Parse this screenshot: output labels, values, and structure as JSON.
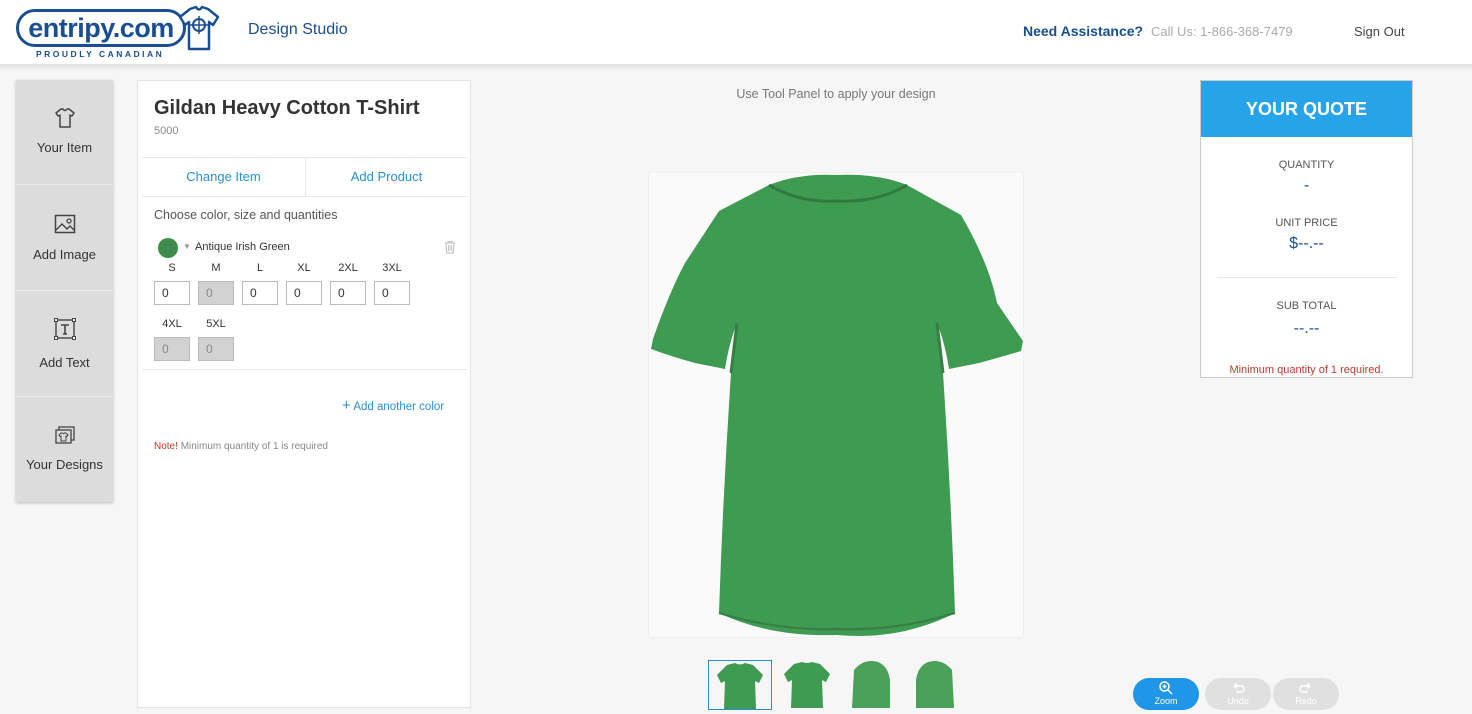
{
  "header": {
    "logo_text": "entripy.com",
    "logo_tagline": "PROUDLY CANADIAN",
    "app_title": "Design Studio",
    "assistance": "Need Assistance?",
    "phone": "Call Us: 1-866-368-7479",
    "sign_out": "Sign Out"
  },
  "toolbar": {
    "items": [
      {
        "label": "Your Item",
        "icon": "tshirt-icon"
      },
      {
        "label": "Add Image",
        "icon": "image-icon"
      },
      {
        "label": "Add Text",
        "icon": "text-icon"
      },
      {
        "label": "Your Designs",
        "icon": "designs-icon"
      }
    ]
  },
  "product": {
    "title": "Gildan Heavy Cotton T-Shirt",
    "code": "5000",
    "change_item": "Change Item",
    "add_product": "Add Product",
    "choose_label": "Choose color, size and quantities",
    "color_name": "Antique Irish Green",
    "color_hex": "#3d8c4a",
    "sizes": [
      {
        "label": "S",
        "value": "0",
        "enabled": true
      },
      {
        "label": "M",
        "value": "0",
        "enabled": false
      },
      {
        "label": "L",
        "value": "0",
        "enabled": true
      },
      {
        "label": "XL",
        "value": "0",
        "enabled": true
      },
      {
        "label": "2XL",
        "value": "0",
        "enabled": true
      },
      {
        "label": "3XL",
        "value": "0",
        "enabled": true
      },
      {
        "label": "4XL",
        "value": "0",
        "enabled": false
      },
      {
        "label": "5XL",
        "value": "0",
        "enabled": false
      }
    ],
    "add_color": "Add another color",
    "note_prefix": "Note!",
    "note_text": "Minimum quantity of 1 is required"
  },
  "canvas": {
    "hint": "Use Tool Panel to apply your design",
    "shirt_color": "#3f9a52"
  },
  "quote": {
    "title": "YOUR QUOTE",
    "quantity_label": "QUANTITY",
    "quantity_value": "-",
    "unit_price_label": "UNIT PRICE",
    "unit_price_value": "$--.--",
    "subtotal_label": "SUB TOTAL",
    "subtotal_value": "--.--",
    "warning": "Minimum quantity of 1 required."
  },
  "controls": {
    "zoom": "Zoom",
    "undo": "Undo",
    "redo": "Redo"
  },
  "colors": {
    "brand_blue": "#1a4e93",
    "accent_blue": "#27a3ea",
    "link_blue": "#2a8fd4",
    "error_red": "#c0392b"
  }
}
